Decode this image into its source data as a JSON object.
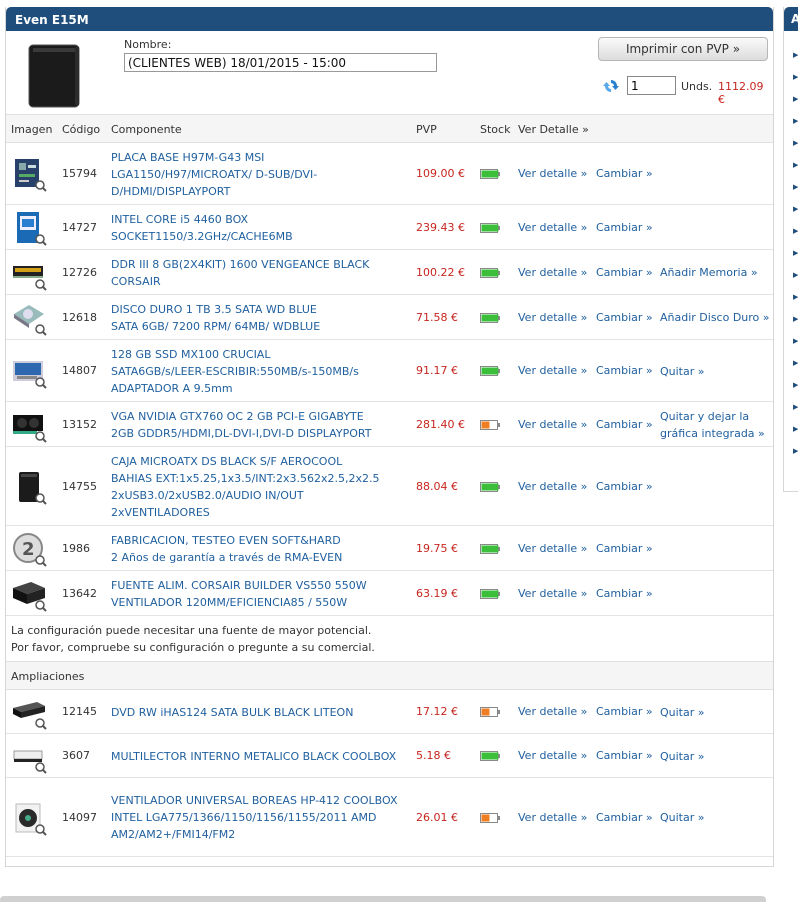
{
  "panel": {
    "title": "Even E15M"
  },
  "config": {
    "name_label": "Nombre:",
    "name_value": "(CLIENTES WEB) 18/01/2015 - 15:00",
    "print_label": "Imprimir con PVP »",
    "quantity": "1",
    "units_label": "Unds.",
    "total": "1112.09 €"
  },
  "table": {
    "headers": {
      "image": "Imagen",
      "code": "Código",
      "component": "Componente",
      "pvp": "PVP",
      "stock": "Stock",
      "detail": "Ver Detalle »"
    }
  },
  "components": [
    {
      "code": "15794",
      "lines": [
        "PLACA BASE H97M-G43 MSI",
        "LGA1150/H97/MICROATX/ D-SUB/DVI-",
        "D/HDMI/DISPLAYPORT"
      ],
      "price": "109.00 €",
      "stock": "green",
      "detail": "Ver detalle »",
      "change": "Cambiar »",
      "extra": [],
      "icon": "motherboard-icon"
    },
    {
      "code": "14727",
      "lines": [
        "INTEL CORE i5 4460 BOX",
        "SOCKET1150/3.2GHz/CACHE6MB"
      ],
      "price": "239.43 €",
      "stock": "green",
      "detail": "Ver detalle »",
      "change": "Cambiar »",
      "extra": [],
      "icon": "cpu-box-icon"
    },
    {
      "code": "12726",
      "lines": [
        "DDR III 8 GB(2X4KIT) 1600 VENGEANCE BLACK",
        "CORSAIR"
      ],
      "price": "100.22 €",
      "stock": "green",
      "detail": "Ver detalle »",
      "change": "Cambiar »",
      "extra": [
        "Añadir Memoria »"
      ],
      "icon": "ram-icon"
    },
    {
      "code": "12618",
      "lines": [
        "DISCO DURO 1 TB 3.5 SATA WD BLUE",
        "SATA 6GB/ 7200 RPM/ 64MB/ WDBLUE"
      ],
      "price": "71.58 €",
      "stock": "green",
      "detail": "Ver detalle »",
      "change": "Cambiar »",
      "extra": [
        "Añadir Disco Duro »"
      ],
      "icon": "hard-drive-icon"
    },
    {
      "code": "14807",
      "lines": [
        "128 GB SSD MX100 CRUCIAL",
        "SATA6GB/s/LEER-ESCRIBIR:550MB/s-150MB/s",
        "ADAPTADOR A 9.5mm"
      ],
      "price": "91.17 €",
      "stock": "green",
      "detail": "Ver detalle »",
      "change": "Cambiar »",
      "extra": [
        "Quitar »"
      ],
      "icon": "ssd-icon"
    },
    {
      "code": "13152",
      "lines": [
        "VGA NVIDIA GTX760 OC 2 GB PCI-E GIGABYTE",
        "2GB GDDR5/HDMI,DL-DVI-I,DVI-D DISPLAYPORT"
      ],
      "price": "281.40 €",
      "stock": "orange",
      "detail": "Ver detalle »",
      "change": "Cambiar »",
      "extra": [
        "Quitar y dejar la",
        "gráfica integrada »"
      ],
      "icon": "graphics-card-icon"
    },
    {
      "code": "14755",
      "lines": [
        "CAJA MICROATX DS BLACK S/F AEROCOOL",
        "BAHIAS EXT:1x5.25,1x3.5/INT:2x3.562x2.5,2x2.5",
        "2xUSB3.0/2xUSB2.0/AUDIO IN/OUT",
        "2xVENTILADORES"
      ],
      "price": "88.04 €",
      "stock": "green",
      "detail": "Ver detalle »",
      "change": "Cambiar »",
      "extra": [],
      "icon": "pc-case-icon"
    },
    {
      "code": "1986",
      "lines": [
        "FABRICACION, TESTEO EVEN SOFT&HARD",
        "2 Años de garantía a través de RMA-EVEN"
      ],
      "price": "19.75 €",
      "stock": "green",
      "detail": "Ver detalle »",
      "change": "Cambiar »",
      "extra": [],
      "icon": "warranty-icon"
    },
    {
      "code": "13642",
      "lines": [
        "FUENTE ALIM. CORSAIR BUILDER VS550 550W",
        "VENTILADOR 120MM/EFICIENCIA85 / 550W"
      ],
      "price": "63.19 €",
      "stock": "green",
      "detail": "Ver detalle »",
      "change": "Cambiar »",
      "extra": [],
      "icon": "power-supply-icon"
    }
  ],
  "notice": [
    "La configuración puede necesitar una fuente de mayor potencial.",
    "Por favor, compruebe su configuración o pregunte a su comercial."
  ],
  "ampliaciones_title": "Ampliaciones",
  "extras": [
    {
      "code": "12145",
      "lines": [
        "DVD RW iHAS124 SATA BULK BLACK LITEON"
      ],
      "price": "17.12 €",
      "stock": "orange",
      "detail": "Ver detalle »",
      "change": "Cambiar »",
      "extra": [
        "Quitar »"
      ],
      "icon": "dvd-drive-icon"
    },
    {
      "code": "3607",
      "lines": [
        "MULTILECTOR INTERNO METALICO BLACK COOLBOX"
      ],
      "price": "5.18 €",
      "stock": "green",
      "detail": "Ver detalle »",
      "change": "Cambiar »",
      "extra": [
        "Quitar »"
      ],
      "icon": "card-reader-icon"
    },
    {
      "code": "14097",
      "lines": [
        "VENTILADOR UNIVERSAL BOREAS HP-412 COOLBOX",
        "INTEL LGA775/1366/1150/1156/1155/2011 AMD",
        "AM2/AM2+/FMI14/FM2"
      ],
      "price": "26.01 €",
      "stock": "orange",
      "detail": "Ver detalle »",
      "change": "Cambiar »",
      "extra": [
        "Quitar »"
      ],
      "icon": "cpu-cooler-icon"
    }
  ],
  "right_panel": {
    "title": "A"
  },
  "colors": {
    "header": "#1f4e7c",
    "link": "#1f5f9e",
    "price": "#c7251f",
    "stock_green": "#3bbf3b",
    "stock_orange": "#ef7d22"
  }
}
